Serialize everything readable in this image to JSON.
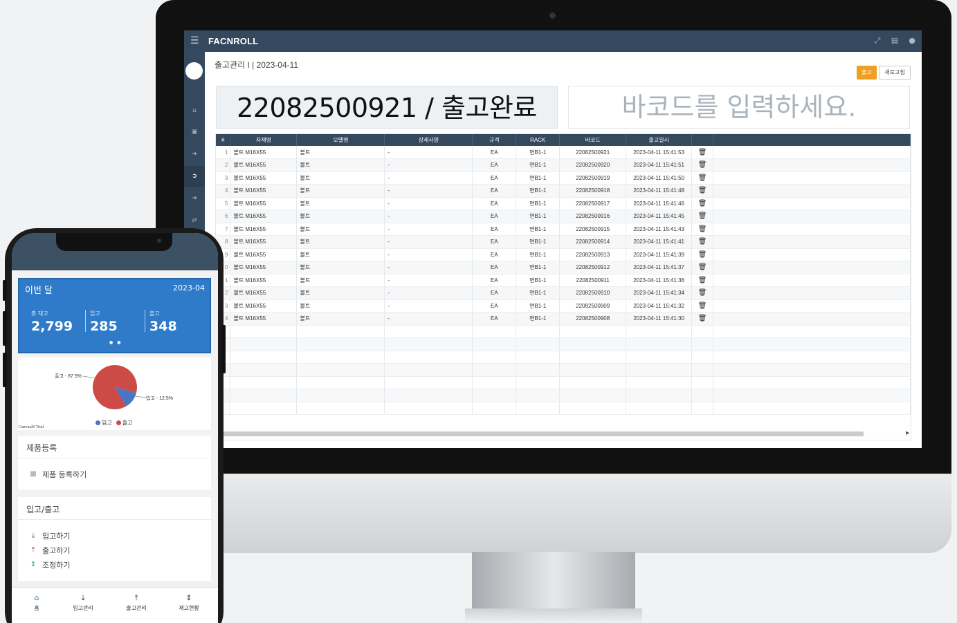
{
  "desktop": {
    "app_title": "FACNROLL",
    "breadcrumb": "출고관리 I | 2023-04-11",
    "btn_out": "출고",
    "btn_refresh": "새로고침",
    "result_text": "22082500921 / 출고완료",
    "barcode_placeholder": "바코드를 입력하세요.",
    "columns": [
      "#",
      "자재명",
      "모델명",
      "상세사양",
      "규격",
      "RACK",
      "바코드",
      "출고일시",
      ""
    ],
    "rows": [
      [
        "1",
        "볼트 M16X55",
        "볼트",
        "-",
        "EA",
        "면B1-1",
        "22082500921",
        "2023-04-11 15:41:53"
      ],
      [
        "2",
        "볼트 M16X55",
        "볼트",
        "-",
        "EA",
        "면B1-1",
        "22082500920",
        "2023-04-11 15:41:51"
      ],
      [
        "3",
        "볼트 M16X55",
        "볼트",
        "-",
        "EA",
        "면B1-1",
        "22082500919",
        "2023-04-11 15:41:50"
      ],
      [
        "4",
        "볼트 M16X55",
        "볼트",
        "-",
        "EA",
        "면B1-1",
        "22082500918",
        "2023-04-11 15:41:48"
      ],
      [
        "5",
        "볼트 M16X55",
        "볼트",
        "-",
        "EA",
        "면B1-1",
        "22082500917",
        "2023-04-11 15:41:46"
      ],
      [
        "6",
        "볼트 M16X55",
        "볼트",
        "-",
        "EA",
        "면B1-1",
        "22082500916",
        "2023-04-11 15:41:45"
      ],
      [
        "7",
        "볼트 M16X55",
        "볼트",
        "-",
        "EA",
        "면B1-1",
        "22082500915",
        "2023-04-11 15:41:43"
      ],
      [
        "8",
        "볼트 M16X55",
        "볼트",
        "-",
        "EA",
        "면B1-1",
        "22082500914",
        "2023-04-11 15:41:41"
      ],
      [
        "9",
        "볼트 M16X55",
        "볼트",
        "-",
        "EA",
        "면B1-1",
        "22082500913",
        "2023-04-11 15:41:39"
      ],
      [
        "0",
        "볼트 M16X55",
        "볼트",
        "-",
        "EA",
        "면B1-1",
        "22082500912",
        "2023-04-11 15:41:37"
      ],
      [
        "1",
        "볼트 M16X55",
        "볼트",
        "-",
        "EA",
        "면B1-1",
        "22082500911",
        "2023-04-11 15:41:36"
      ],
      [
        "2",
        "볼트 M16X55",
        "볼트",
        "-",
        "EA",
        "면B1-1",
        "22082500910",
        "2023-04-11 15:41:34"
      ],
      [
        "3",
        "볼트 M16X55",
        "볼트",
        "-",
        "EA",
        "면B1-1",
        "22082500909",
        "2023-04-11 15:41:32"
      ],
      [
        "4",
        "볼트 M16X55",
        "볼트",
        "-",
        "EA",
        "면B1-1",
        "22082500908",
        "2023-04-11 15:41:30"
      ]
    ],
    "empty_rows": 7,
    "sidebar_icons": [
      "home-icon",
      "inbox-icon",
      "sign-in-icon",
      "sign-out-icon",
      "export-icon",
      "exchange-icon"
    ],
    "top_icons": [
      "fullscreen-icon",
      "document-icon",
      "user-icon"
    ]
  },
  "mobile": {
    "card_title": "이번 달",
    "card_date": "2023-04",
    "stats": [
      {
        "label": "총 재고",
        "value": "2,799"
      },
      {
        "label": "입고",
        "value": "285"
      },
      {
        "label": "출고",
        "value": "348"
      }
    ],
    "chart_data": {
      "type": "pie",
      "slices": [
        {
          "name": "출고",
          "value": 87.5,
          "color": "#cc4b47"
        },
        {
          "name": "입고",
          "value": 12.5,
          "color": "#4a74c4"
        }
      ],
      "labels": [
        "출고 - 87.5%",
        "입고 - 12.5%"
      ],
      "legend": [
        "입고",
        "출고"
      ],
      "legend_placement": "bottom",
      "watermark": "CanvasJS Trial"
    },
    "section1": {
      "title": "제품등록",
      "items": [
        "제품 등록하기"
      ]
    },
    "section2": {
      "title": "입고/출고",
      "items": [
        "입고하기",
        "출고하기",
        "조정하기"
      ]
    },
    "nav": [
      "홈",
      "입고관리",
      "출고관리",
      "재고현황"
    ]
  }
}
